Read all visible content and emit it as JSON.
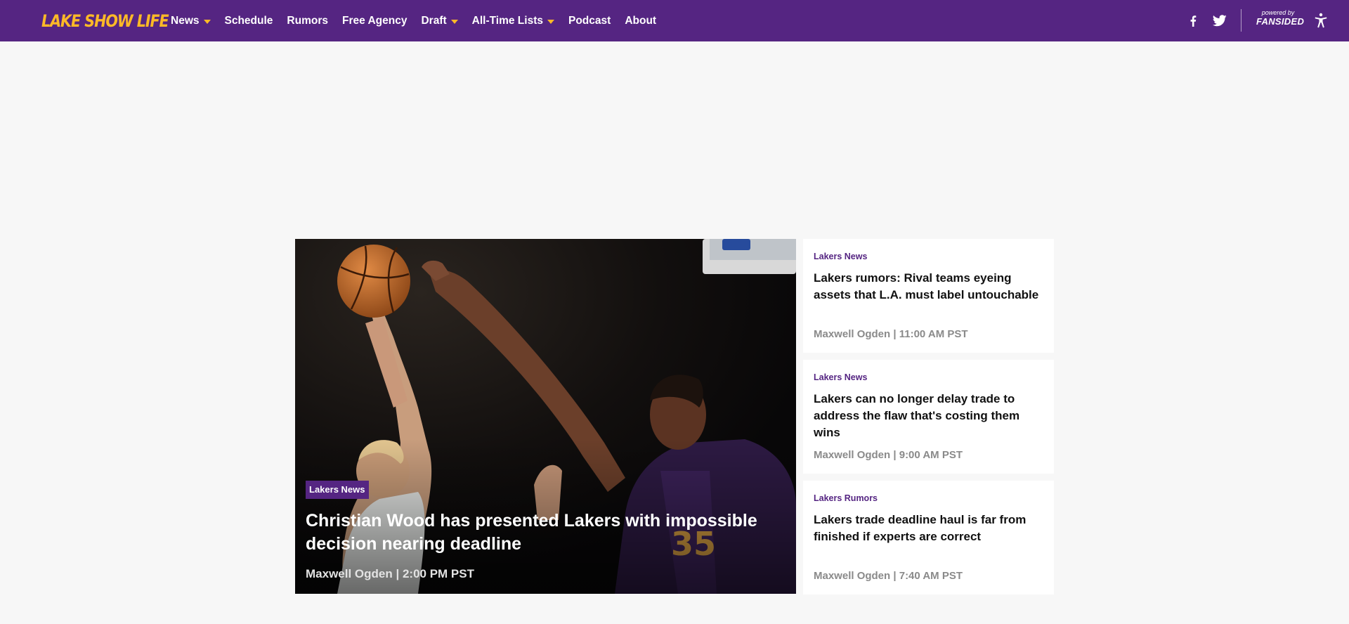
{
  "site": {
    "logo_text": "LAKE SHOW LIFE",
    "brand_colors": {
      "primary": "#552582",
      "accent": "#fdb927"
    }
  },
  "nav": {
    "items": [
      {
        "label": "News",
        "has_dropdown": true
      },
      {
        "label": "Schedule",
        "has_dropdown": false
      },
      {
        "label": "Rumors",
        "has_dropdown": false
      },
      {
        "label": "Free Agency",
        "has_dropdown": false
      },
      {
        "label": "Draft",
        "has_dropdown": true
      },
      {
        "label": "All-Time Lists",
        "has_dropdown": true
      },
      {
        "label": "Podcast",
        "has_dropdown": false
      },
      {
        "label": "About",
        "has_dropdown": false
      }
    ],
    "social_icons": [
      "facebook-icon",
      "twitter-icon"
    ],
    "powered_by": "powered by",
    "network": "FANSIDED",
    "accessibility_icon": "accessibility-icon"
  },
  "hero": {
    "category": "Lakers News",
    "title": "Christian Wood has presented Lakers with impossible decision nearing deadline",
    "meta": "Maxwell Ogden | 2:00 PM PST",
    "image_description_icon": "basketball-photo"
  },
  "cards": [
    {
      "category": "Lakers News",
      "title": "Lakers rumors: Rival teams eyeing assets that L.A. must label untouchable",
      "meta": "Maxwell Ogden | 11:00 AM PST"
    },
    {
      "category": "Lakers News",
      "title": "Lakers can no longer delay trade to address the flaw that's costing them wins",
      "meta": "Maxwell Ogden | 9:00 AM PST"
    },
    {
      "category": "Lakers Rumors",
      "title": "Lakers trade deadline haul is far from finished if experts are correct",
      "meta": "Maxwell Ogden | 7:40 AM PST"
    }
  ]
}
